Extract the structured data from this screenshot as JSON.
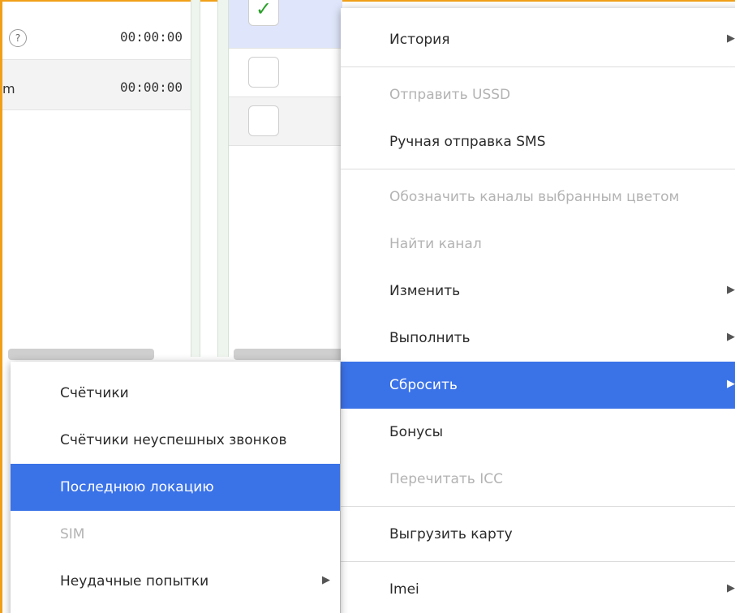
{
  "grid": {
    "rows": [
      {
        "text": "",
        "time": "00:00:00",
        "has_help": true
      },
      {
        "text": "m",
        "time": "00:00:00",
        "has_help": false
      }
    ],
    "help_glyph": "?",
    "checkbox_rows": [
      {
        "checked": true
      },
      {
        "checked": false
      },
      {
        "checked": false
      }
    ],
    "check_glyph": "✓"
  },
  "context_menu": {
    "items": [
      {
        "label": "История",
        "disabled": false,
        "submenu": true,
        "active": false
      },
      {
        "label": "Отправить USSD",
        "disabled": true,
        "submenu": false,
        "active": false
      },
      {
        "label": "Ручная отправка SMS",
        "disabled": false,
        "submenu": false,
        "active": false
      },
      {
        "label": "Обозначить каналы выбранным цветом",
        "disabled": true,
        "submenu": false,
        "active": false
      },
      {
        "label": "Найти канал",
        "disabled": true,
        "submenu": false,
        "active": false
      },
      {
        "label": "Изменить",
        "disabled": false,
        "submenu": true,
        "active": false
      },
      {
        "label": "Выполнить",
        "disabled": false,
        "submenu": true,
        "active": false
      },
      {
        "label": "Сбросить",
        "disabled": false,
        "submenu": true,
        "active": true
      },
      {
        "label": "Бонусы",
        "disabled": false,
        "submenu": false,
        "active": false
      },
      {
        "label": "Перечитать ICC",
        "disabled": true,
        "submenu": false,
        "active": false
      },
      {
        "label": "Выгрузить карту",
        "disabled": false,
        "submenu": false,
        "active": false
      },
      {
        "label": "Imei",
        "disabled": false,
        "submenu": true,
        "active": false
      }
    ]
  },
  "reset_submenu": {
    "items": [
      {
        "label": "Счётчики",
        "disabled": false,
        "submenu": false,
        "active": false
      },
      {
        "label": "Счётчики неуспешных звонков",
        "disabled": false,
        "submenu": false,
        "active": false
      },
      {
        "label": "Последнюю локацию",
        "disabled": false,
        "submenu": false,
        "active": true
      },
      {
        "label": "SIM",
        "disabled": true,
        "submenu": false,
        "active": false
      },
      {
        "label": "Неудачные попытки",
        "disabled": false,
        "submenu": true,
        "active": false
      }
    ]
  },
  "submenu_arrow_glyph": "▶",
  "colors": {
    "accent": "#3a72e8",
    "frame": "#f0a018",
    "check": "#2aa02a",
    "disabled_text": "#b3b3b3"
  }
}
